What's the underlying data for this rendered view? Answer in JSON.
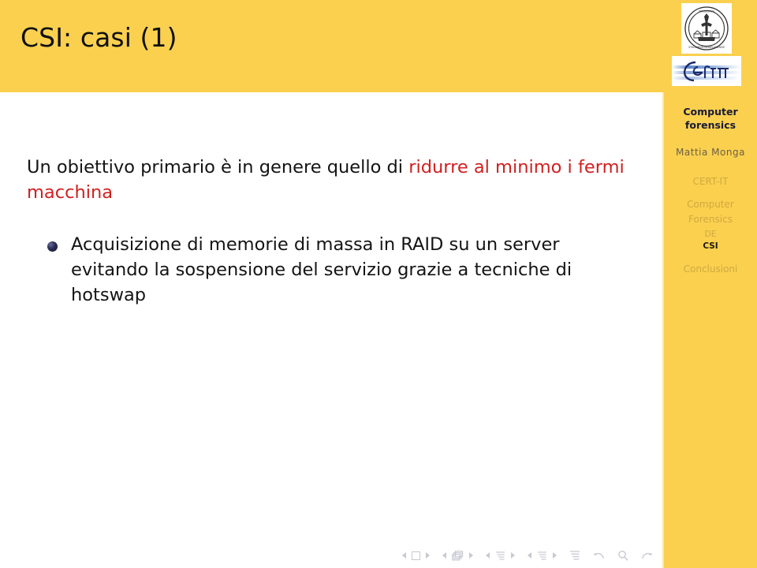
{
  "slide": {
    "title": "CSI: casi (1)",
    "header_color": "#fbd04f",
    "alert_color": "#d02020",
    "bullet_color": "#2b2d55"
  },
  "logos": {
    "seal_name": "universita-degli-studi-di-milano-seal",
    "certit_name": "cert-it-logo",
    "certit_text": "Cert-it"
  },
  "sidebar": {
    "title_line1": "Computer",
    "title_line2": "forensics",
    "author": "Mattia Monga",
    "nav": [
      {
        "label": "CERT-IT",
        "level": "section",
        "current": false
      },
      {
        "label": "Computer",
        "level": "section",
        "current": false
      },
      {
        "label": "Forensics",
        "level": "section",
        "current": false
      },
      {
        "label": "DE",
        "level": "subsection",
        "current": false
      },
      {
        "label": "CSI",
        "level": "subsection",
        "current": true
      },
      {
        "label": "Conclusioni",
        "level": "section",
        "current": false
      }
    ]
  },
  "body": {
    "paragraph": {
      "part1": "Un obiettivo primario è in genere quello di ",
      "alert": "ridurre al minimo i fermi macchina"
    },
    "items": [
      "Acquisizione di memorie di massa in RAID su un server evitando la sospensione del servizio grazie a tecniche di hotswap"
    ]
  },
  "navbar": {
    "groups": [
      {
        "icon": "slide-frame-icon",
        "prev": "◂",
        "next": "▸"
      },
      {
        "icon": "stacked-frames-icon",
        "prev": "◂",
        "next": "▸"
      },
      {
        "icon": "subsection-lines-icon",
        "prev": "◂",
        "next": "▸"
      },
      {
        "icon": "section-lines-icon",
        "prev": "◂",
        "next": "▸"
      }
    ],
    "extras": [
      {
        "icon": "document-lines-icon"
      },
      {
        "icon": "back-arrow-icon"
      },
      {
        "icon": "search-icon"
      },
      {
        "icon": "forward-arrow-icon"
      }
    ]
  }
}
